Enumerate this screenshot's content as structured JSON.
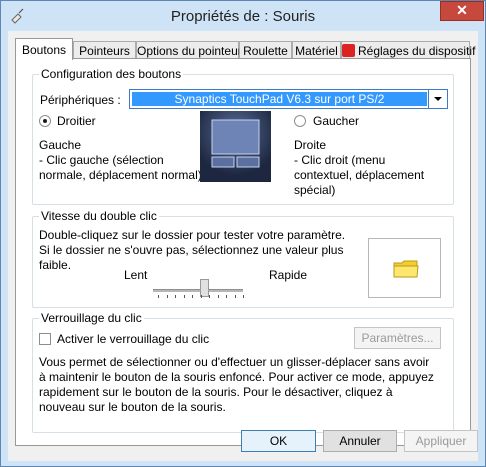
{
  "window": {
    "title": "Propriétés de : Souris",
    "close_label": "✕"
  },
  "tabs": [
    {
      "label": "Boutons"
    },
    {
      "label": "Pointeurs"
    },
    {
      "label": "Options du pointeur"
    },
    {
      "label": "Roulette"
    },
    {
      "label": "Matériel"
    },
    {
      "label": "Réglages du dispositif"
    }
  ],
  "buttons_config": {
    "group_title": "Configuration des boutons",
    "device_label": "Périphériques :",
    "device_value": "Synaptics TouchPad V6.3 sur port PS/2",
    "right_handed_label": "Droitier",
    "left_handed_label": "Gaucher",
    "left_title": "Gauche",
    "left_desc": " - Clic gauche (sélection normale, déplacement normal)",
    "right_title": "Droite",
    "right_desc": " - Clic droit (menu contextuel, déplacement spécial)"
  },
  "double_click": {
    "group_title": "Vitesse du double clic",
    "description": "Double-cliquez sur le dossier pour tester votre paramètre. Si le dossier ne s'ouvre pas, sélectionnez une valeur plus faible.",
    "slow_label": "Lent",
    "fast_label": "Rapide",
    "speed_fraction": 0.58
  },
  "click_lock": {
    "group_title": "Verrouillage du clic",
    "checkbox_label": "Activer le verrouillage du clic",
    "settings_button": "Paramètres...",
    "description": "Vous permet de sélectionner ou d'effectuer un glisser-déplacer sans avoir à maintenir le bouton de la souris enfoncé. Pour activer ce mode, appuyez rapidement sur le bouton de la souris. Pour le désactiver, cliquez à nouveau sur le bouton de la souris."
  },
  "footer": {
    "ok": "OK",
    "cancel": "Annuler",
    "apply": "Appliquer"
  }
}
